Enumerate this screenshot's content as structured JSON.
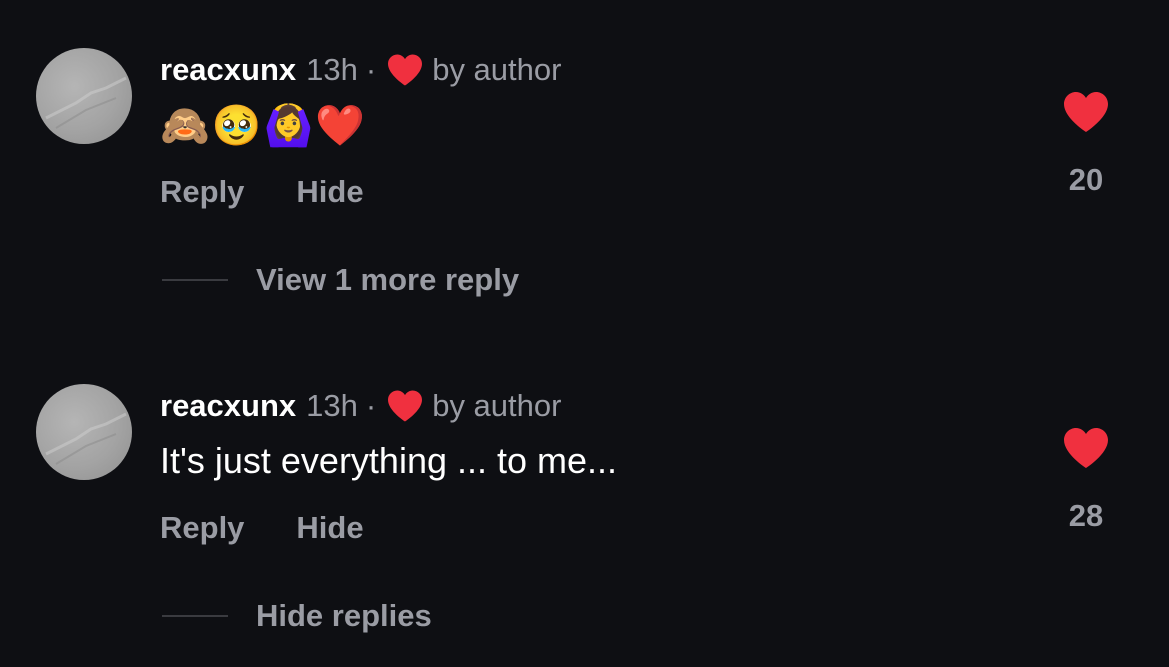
{
  "comments": [
    {
      "username": "reacxunx",
      "time": "13h",
      "separator": "·",
      "author_badge": "by author",
      "body": "🙈🥹🙆‍♀️❤️",
      "reply_label": "Reply",
      "hide_label": "Hide",
      "like_count": "20",
      "replies_toggle": "View 1 more reply"
    },
    {
      "username": "reacxunx",
      "time": "13h",
      "separator": "·",
      "author_badge": "by author",
      "body": "It's just everything ... to me...",
      "reply_label": "Reply",
      "hide_label": "Hide",
      "like_count": "28",
      "replies_toggle": "Hide replies"
    }
  ],
  "colors": {
    "background": "#0e0f13",
    "heart": "#f0303f",
    "muted_text": "#9a9ca4",
    "primary_text": "#ffffff"
  },
  "icons": {
    "author_heart": "heart-icon",
    "like": "heart-icon",
    "avatar": "avatar"
  }
}
